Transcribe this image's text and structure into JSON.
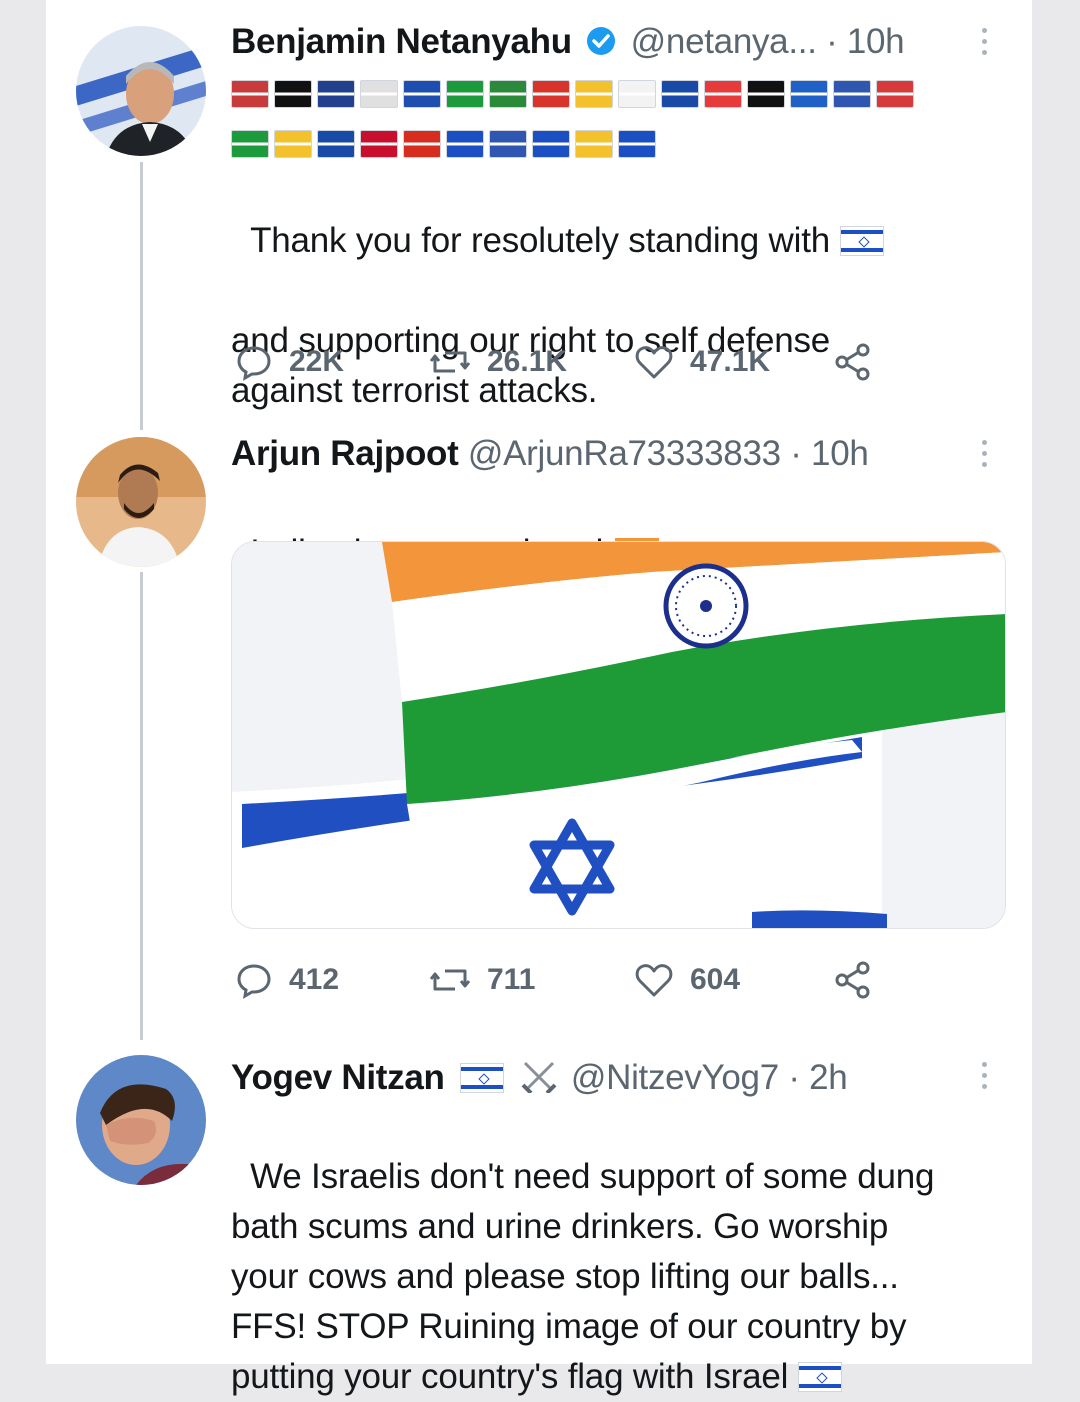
{
  "tweets": [
    {
      "name": "Benjamin Netanyahu",
      "verified": true,
      "handle": "@netanya...",
      "time": "· 10h",
      "text": "Thank you for resolutely standing with",
      "text_rest": "and supporting our right to self defense\nagainst terrorist attacks.",
      "flags_row1": [
        "#c93a3a",
        "#111111",
        "#23408e",
        "#e0e0e0",
        "#1e4fb0",
        "#1d9a3c",
        "#2a8a3a",
        "#d8342c",
        "#f3c12b",
        "#f3f3f3",
        "#1a4aa8",
        "#e73b3b",
        "#111111",
        "#2061c7",
        "#2f56b0",
        "#d63a3a"
      ],
      "flags_row2": [
        "#1d9a3c",
        "#f3c12b",
        "#1a4aa8",
        "#c8102e",
        "#d62d1f",
        "#1c4fc4",
        "#2f56b0",
        "#1c4fc4",
        "#f3c12b",
        "#1c4fc4"
      ],
      "replies": "22K",
      "retweets": "26.1K",
      "likes": "47.1K"
    },
    {
      "name": "Arjun Rajpoot",
      "handle": "@ArjunRa73333833",
      "time": "· 10h",
      "text": "India also supporting sir",
      "replies": "412",
      "retweets": "711",
      "likes": "604"
    },
    {
      "name": "Yogev Nitzan",
      "handle": "@NitzevYog7",
      "time": "· 2h",
      "text": "We Israelis don't need support of some dung\nbath scums and urine drinkers. Go worship\nyour cows and please stop lifting our balls...\nFFS! STOP Ruining image of our country by\nputting your country's flag with Israel"
    }
  ],
  "icons": {
    "reply": "reply-icon",
    "retweet": "retweet-icon",
    "like": "heart-icon",
    "share": "share-icon",
    "more": "more-vertical-icon",
    "verified": "verified-badge-icon",
    "swords": "crossed-swords-icon"
  },
  "colors": {
    "verified": "#1d9bf0",
    "text": "#14171a",
    "muted": "#5b6670",
    "thread": "#c6ccd2"
  }
}
